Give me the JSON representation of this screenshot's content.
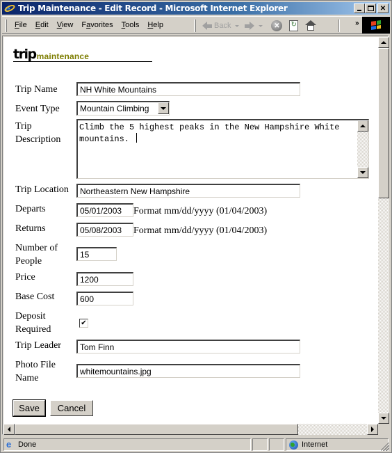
{
  "window": {
    "title": "Trip Maintenance - Edit Record - Microsoft Internet Explorer",
    "controls": [
      "minimize",
      "maximize",
      "close"
    ]
  },
  "menubar": {
    "items": [
      {
        "label": "File",
        "accel": "F"
      },
      {
        "label": "Edit",
        "accel": "E"
      },
      {
        "label": "View",
        "accel": "V"
      },
      {
        "label": "Favorites",
        "accel": "a"
      },
      {
        "label": "Tools",
        "accel": "T"
      },
      {
        "label": "Help",
        "accel": "H"
      }
    ]
  },
  "toolbar": {
    "back_label": "Back",
    "more_label": "»",
    "icons": [
      "back-arrow-icon",
      "forward-arrow-icon",
      "stop-icon",
      "refresh-icon",
      "home-icon"
    ]
  },
  "page": {
    "logo_primary": "trip",
    "logo_secondary": "maintenance",
    "logo_secondary_color": "#7d7d00",
    "form": {
      "trip_name": {
        "label": "Trip Name",
        "value": "NH White Mountains"
      },
      "event_type": {
        "label": "Event Type",
        "value": "Mountain Climbing"
      },
      "trip_description": {
        "label_line1": "Trip",
        "label_line2": "Description",
        "value": "Climb the 5 highest peaks in the New Hampshire White mountains. "
      },
      "trip_location": {
        "label": "Trip Location",
        "value": "Northeastern New Hampshire"
      },
      "departs": {
        "label": "Departs",
        "value": "05/01/2003",
        "hint": "Format mm/dd/yyyy (01/04/2003)"
      },
      "returns": {
        "label": "Returns",
        "value": "05/08/2003",
        "hint": "Format mm/dd/yyyy (01/04/2003)"
      },
      "number_of_people": {
        "label_line1": "Number of",
        "label_line2": "People",
        "value": "15"
      },
      "price": {
        "label": "Price",
        "value": "1200"
      },
      "base_cost": {
        "label": "Base Cost",
        "value": "600"
      },
      "deposit_required": {
        "label_line1": "Deposit",
        "label_line2": "Required",
        "checked": true,
        "check_glyph": "✔"
      },
      "trip_leader": {
        "label": "Trip Leader",
        "value": "Tom Finn"
      },
      "photo_file_name": {
        "label_line1": "Photo File",
        "label_line2": "Name",
        "value": "whitemountains.jpg"
      }
    },
    "buttons": {
      "save": "Save",
      "cancel": "Cancel"
    }
  },
  "statusbar": {
    "status": "Done",
    "zone": "Internet"
  }
}
